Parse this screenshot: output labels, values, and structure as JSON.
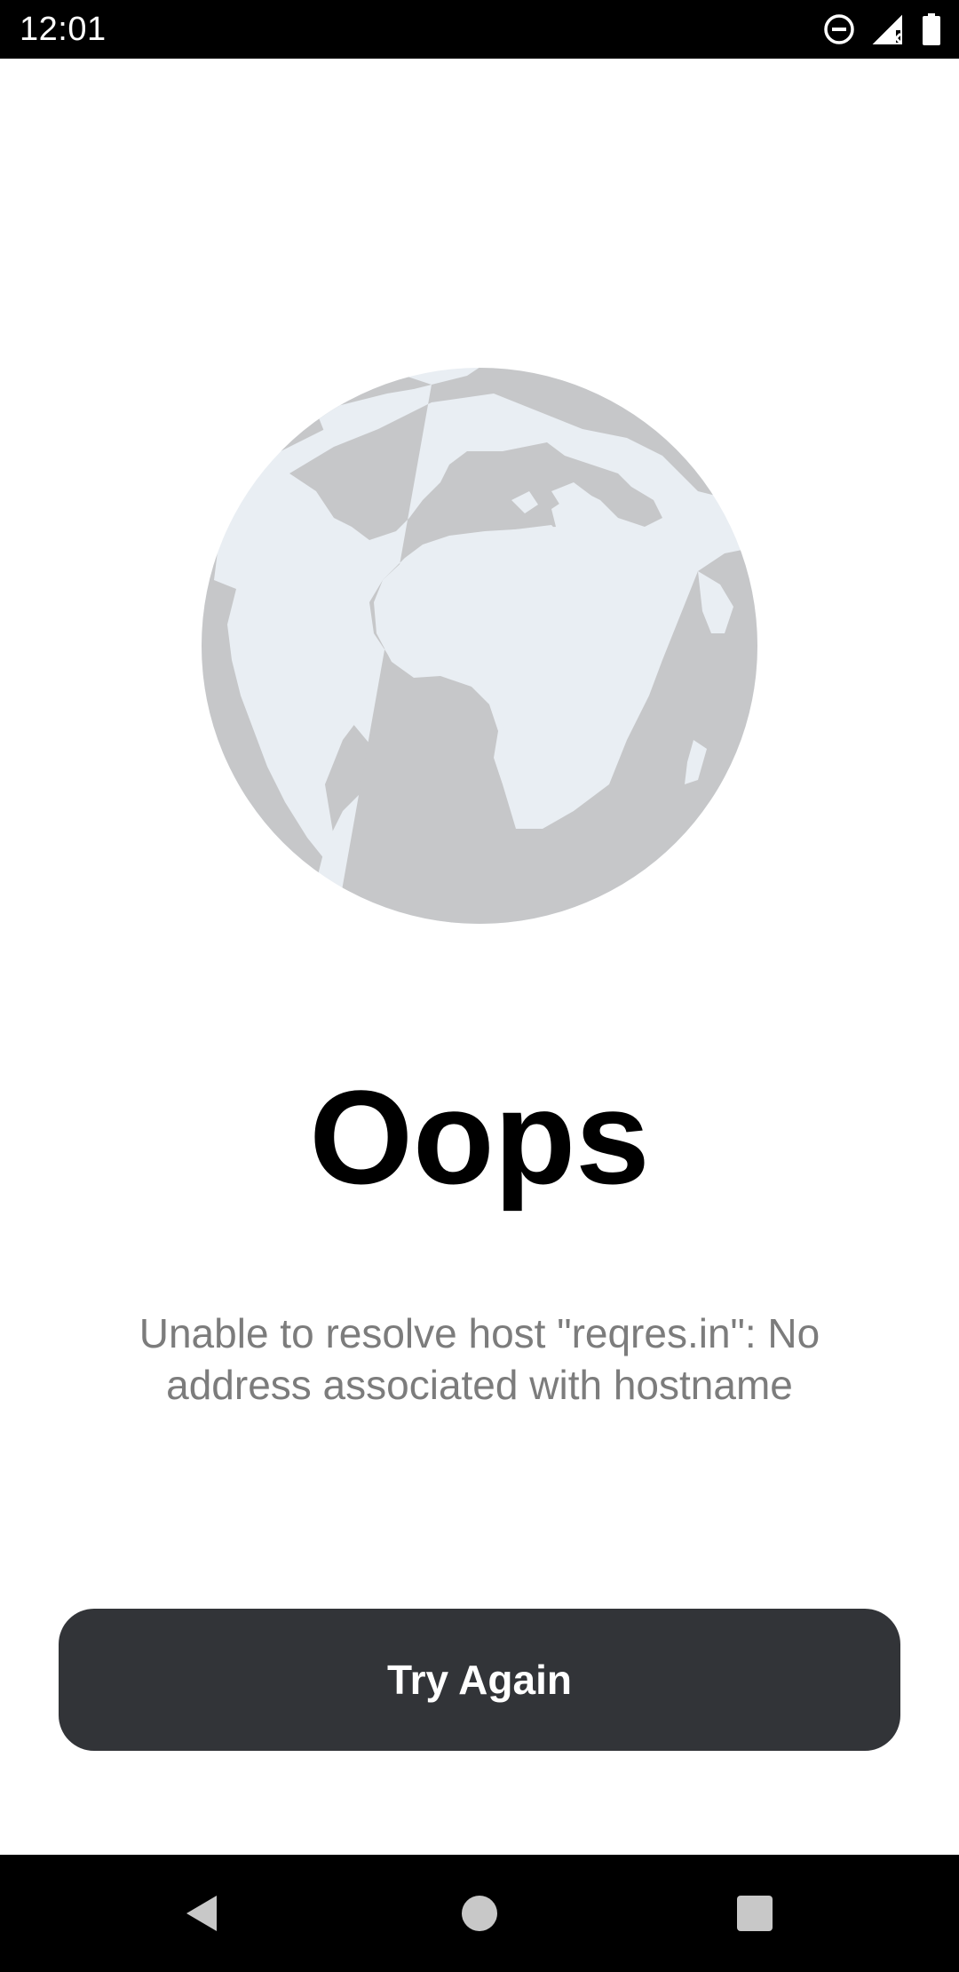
{
  "status_bar": {
    "time": "12:01",
    "icons": [
      "do-not-disturb-icon",
      "signal-no-data-icon",
      "battery-icon"
    ]
  },
  "error_screen": {
    "illustration": "globe-icon",
    "title": "Oops",
    "message": "Unable to resolve host \"reqres.in\": No address associated with hostname",
    "retry_button_label": "Try Again"
  },
  "nav_bar": {
    "buttons": [
      "back-icon",
      "home-icon",
      "recents-icon"
    ]
  },
  "colors": {
    "globe_ocean": "#c6c7c9",
    "globe_land": "#e9eef3",
    "button_bg": "#323438",
    "message_text": "#7c7c7c"
  }
}
